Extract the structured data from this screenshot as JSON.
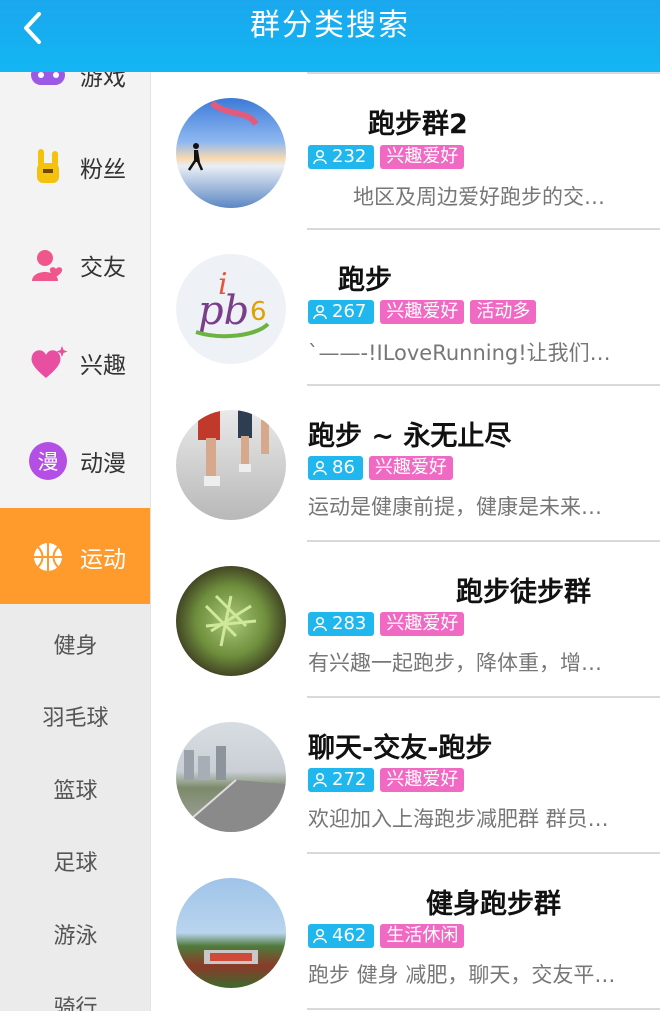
{
  "header": {
    "title": "群分类搜索"
  },
  "sidebar": {
    "categories": [
      {
        "label": "游戏",
        "icon": "gamepad-icon"
      },
      {
        "label": "粉丝",
        "icon": "rock-hand-icon"
      },
      {
        "label": "交友",
        "icon": "person-heart-icon"
      },
      {
        "label": "兴趣",
        "icon": "heart-sparkle-icon"
      },
      {
        "label": "动漫",
        "icon": "manga-badge-icon",
        "badge": "漫"
      },
      {
        "label": "运动",
        "icon": "basketball-icon",
        "active": true
      }
    ],
    "subcategories": [
      "健身",
      "羽毛球",
      "篮球",
      "足球",
      "游泳",
      "骑行"
    ]
  },
  "groups": [
    {
      "name": "跑步群2",
      "members": "232",
      "tags": [
        "兴趣爱好"
      ],
      "desc": "地区及周边爱好跑步的交…",
      "avatar": "runner-sunset"
    },
    {
      "name": "跑步",
      "members": "267",
      "tags": [
        "兴趣爱好",
        "活动多"
      ],
      "desc": "`——-!ILoveRunning!让我们…",
      "avatar": "runner-logo"
    },
    {
      "name": "跑步 ~ 永无止尽",
      "members": "86",
      "tags": [
        "兴趣爱好"
      ],
      "desc": "运动是健康前提，健康是未来…",
      "avatar": "marathon-legs"
    },
    {
      "name": "跑步徒步群",
      "members": "283",
      "tags": [
        "兴趣爱好"
      ],
      "desc": "有兴趣一起跑步，降体重，增…",
      "avatar": "green-tea"
    },
    {
      "name": "聊天-交友-跑步",
      "members": "272",
      "tags": [
        "兴趣爱好"
      ],
      "desc": "欢迎加入上海跑步减肥群 群员…",
      "avatar": "city-road"
    },
    {
      "name": "健身跑步群",
      "members": "462",
      "tags": [
        "生活休闲"
      ],
      "desc": "跑步 健身 减肥，聊天，交友平…",
      "avatar": "stadium"
    }
  ],
  "colors": {
    "header": "#13b0f0",
    "active": "#ff9a2c",
    "count_badge": "#1fb7ee",
    "tag_badge": "#f06ac3"
  }
}
